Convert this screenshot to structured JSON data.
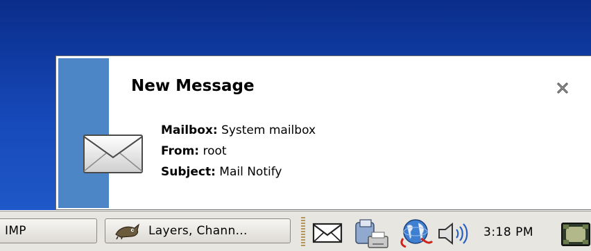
{
  "notification": {
    "title": "New Message",
    "close_icon": "close-x-icon",
    "envelope_icon": "envelope-icon",
    "fields": {
      "mailbox_label": "Mailbox:",
      "mailbox_value": "System mailbox",
      "from_label": "From:",
      "from_value": "root",
      "subject_label": "Subject:",
      "subject_value": "Mail Notify"
    },
    "colors": {
      "stripe": "#4d86c7",
      "background": "#ffffff"
    }
  },
  "taskbar": {
    "tasks": [
      {
        "label": "IMP"
      },
      {
        "label": "Layers, Chann...",
        "icon": "gimp-wilber-icon"
      }
    ],
    "tray": {
      "icons": [
        "mail-envelope-icon",
        "printer-icon",
        "network-globe-icon",
        "volume-speaker-icon",
        "show-desktop-icon"
      ],
      "clock": "3:18 PM"
    }
  },
  "desktop": {
    "background": "#1648b8"
  }
}
